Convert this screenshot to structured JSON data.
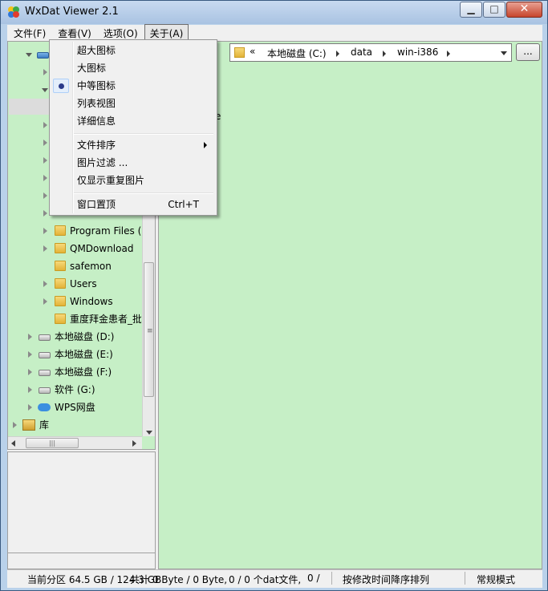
{
  "window": {
    "title": "WxDat Viewer 2.1"
  },
  "menubar": {
    "items": [
      {
        "label": "文件(F)"
      },
      {
        "label": "查看(V)"
      },
      {
        "label": "选项(O)"
      },
      {
        "label": "关于(A)"
      }
    ]
  },
  "dropdown": {
    "items": [
      {
        "label": "超大图标"
      },
      {
        "label": "大图标"
      },
      {
        "label": "中等图标",
        "checked": true
      },
      {
        "label": "列表视图"
      },
      {
        "label": "详细信息"
      },
      {
        "label": "文件排序",
        "submenu": true
      },
      {
        "label": "图片过滤 ..."
      },
      {
        "label": "仅显示重复图片"
      },
      {
        "label": "窗口置顶",
        "shortcut": "Ctrl+T"
      }
    ]
  },
  "tree": {
    "items": [
      {
        "label": "Program Files (",
        "icon": "folder-icon"
      },
      {
        "label": "QMDownload",
        "icon": "folder-icon"
      },
      {
        "label": "safemon",
        "icon": "folder-icon"
      },
      {
        "label": "Users",
        "icon": "folder-icon"
      },
      {
        "label": "Windows",
        "icon": "folder-icon"
      },
      {
        "label": "重度拜金患者_批",
        "icon": "folder-icon"
      },
      {
        "label": "本地磁盘 (D:)",
        "icon": "drive-icon"
      },
      {
        "label": "本地磁盘 (E:)",
        "icon": "drive-icon"
      },
      {
        "label": "本地磁盘 (F:)",
        "icon": "drive-icon"
      },
      {
        "label": "软件 (G:)",
        "icon": "drive-icon"
      },
      {
        "label": "WPS网盘",
        "icon": "cloud-icon"
      },
      {
        "label": "库",
        "icon": "library-icon"
      }
    ]
  },
  "address": {
    "chevron": "«",
    "crumbs": [
      "本地磁盘 (C:)",
      "data",
      "win-i386"
    ],
    "browse_label": "..."
  },
  "main": {
    "partial_text": "e"
  },
  "status": {
    "segments": [
      "当前分区 64.5 GB / 124.3 GB",
      "共计 0 Byte / 0 Byte,",
      "0 / 0 个dat文件,",
      "0 /",
      "按修改时间降序排列",
      "常规模式"
    ]
  },
  "colors": {
    "pane_bg": "#c6efc6",
    "window_frame": "#b9d1ea"
  }
}
